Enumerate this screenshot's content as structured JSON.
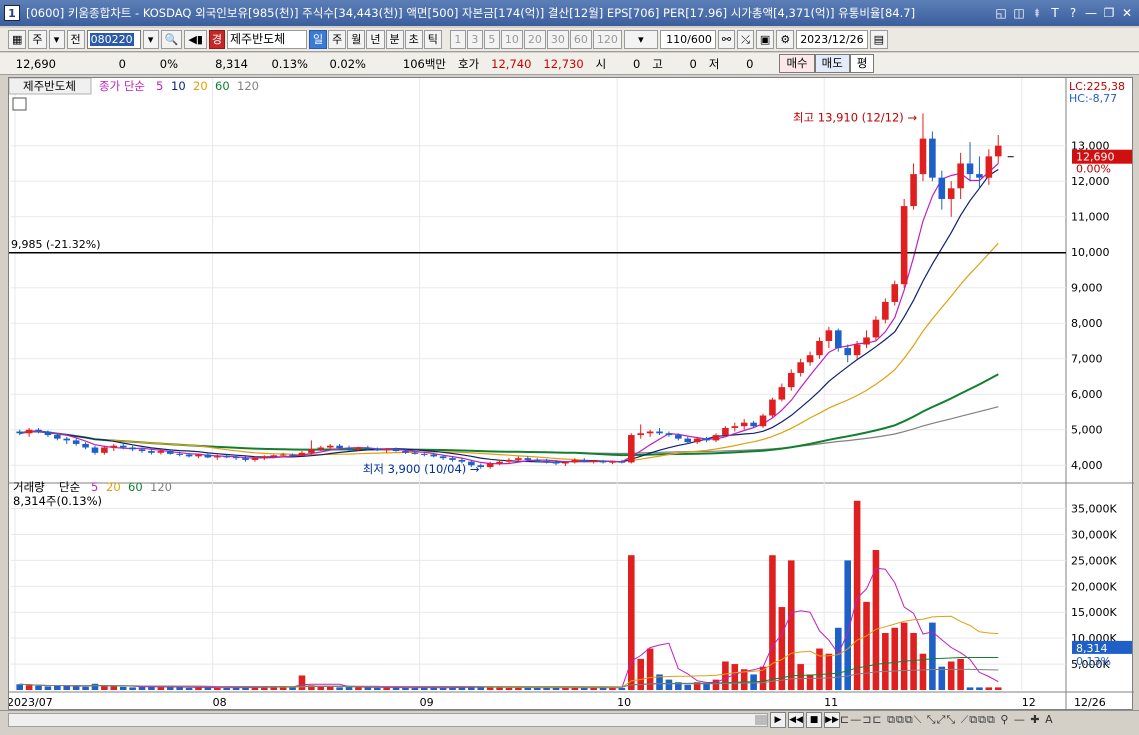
{
  "window": {
    "icon_label": "1",
    "title": "[0600] 키움종합차트 - KOSDAQ 외국인보유[985(천)] 주식수[34,443(천)] 액면[500] 자본금[174(억)] 결산[12월] EPS[706] PER[17.96] 시가총액[4,371(억)] 유통비율[84.7]",
    "controls": [
      "◱",
      "◫",
      "⯒",
      "T",
      "?",
      "—",
      "❐",
      "✕"
    ]
  },
  "toolbar": {
    "type_label": "주",
    "prev_label": "전",
    "code": "080220",
    "market_badge": "경",
    "stock_name": "제주반도체",
    "periods": [
      "일",
      "주",
      "월",
      "년",
      "분",
      "초",
      "틱"
    ],
    "active_period": "일",
    "intervals": [
      "1",
      "3",
      "5",
      "10",
      "20",
      "30",
      "60",
      "120"
    ],
    "count": "110/600",
    "date": "2023/12/26"
  },
  "info": {
    "price": "12,690",
    "change": "0",
    "change_pct": "0%",
    "volume": "8,314",
    "vol_ratio": "0.13%",
    "turnover": "0.02%",
    "amount": "106백만",
    "quote_label": "호가",
    "ask": "12,740",
    "bid": "12,730",
    "open_label": "시",
    "open": "0",
    "high_label": "고",
    "high": "0",
    "low_label": "저",
    "low": "0",
    "buy_label": "매수",
    "sell_label": "매도",
    "avg_label": "평"
  },
  "price_panel": {
    "name": "제주반도체",
    "legend_close": "종가 단순",
    "ma_periods": [
      "5",
      "10",
      "20",
      "60",
      "120"
    ],
    "lc": "LC:225,38",
    "hc": "HC:-8,77",
    "current_price": "12,690",
    "current_pct": "0.00%",
    "high_annot": "최고 13,910 (12/12)",
    "low_annot": "최저 3,900 (10/04)",
    "hline_label": "9,985 (-21.32%)",
    "y_ticks": [
      "13,000",
      "12,000",
      "11,000",
      "10,000",
      "9,000",
      "8,000",
      "7,000",
      "6,000",
      "5,000",
      "4,000"
    ]
  },
  "volume_panel": {
    "name": "거래량",
    "legend_ma": "단순",
    "ma_periods": [
      "5",
      "20",
      "60",
      "120"
    ],
    "current": "8,314주(0.13%)",
    "current_tag": "8,314",
    "current_pct": "0.13%",
    "y_ticks": [
      "35,000K",
      "30,000K",
      "25,000K",
      "20,000K",
      "15,000K",
      "10,000K",
      "5,000K"
    ]
  },
  "x_axis": [
    "2023/07",
    "08",
    "09",
    "10",
    "11",
    "12",
    "12/26"
  ],
  "colors": {
    "up": "#e02020",
    "down": "#1f5fc8",
    "ma5": "#c020c0",
    "ma10": "#102070",
    "ma20": "#e0a010",
    "ma60": "#108030",
    "ma120": "#808080"
  },
  "chart_data": {
    "type": "candlestick",
    "price_ylim": [
      3500,
      14400
    ],
    "volume_ylim": [
      0,
      38000
    ],
    "candles": [
      [
        4950,
        5000,
        4850,
        4900
      ],
      [
        4900,
        5050,
        4800,
        5000
      ],
      [
        5000,
        5050,
        4900,
        4950
      ],
      [
        4950,
        4980,
        4800,
        4850
      ],
      [
        4850,
        4900,
        4700,
        4750
      ],
      [
        4750,
        4800,
        4600,
        4700
      ],
      [
        4700,
        4750,
        4550,
        4600
      ],
      [
        4600,
        4650,
        4450,
        4500
      ],
      [
        4500,
        4550,
        4300,
        4350
      ],
      [
        4350,
        4550,
        4300,
        4500
      ],
      [
        4500,
        4600,
        4400,
        4550
      ],
      [
        4550,
        4600,
        4450,
        4500
      ],
      [
        4500,
        4550,
        4400,
        4450
      ],
      [
        4450,
        4500,
        4350,
        4400
      ],
      [
        4400,
        4450,
        4300,
        4350
      ],
      [
        4350,
        4450,
        4300,
        4400
      ],
      [
        4400,
        4420,
        4300,
        4320
      ],
      [
        4320,
        4380,
        4250,
        4300
      ],
      [
        4300,
        4350,
        4220,
        4250
      ],
      [
        4250,
        4320,
        4200,
        4300
      ],
      [
        4300,
        4330,
        4200,
        4220
      ],
      [
        4220,
        4300,
        4150,
        4250
      ],
      [
        4250,
        4300,
        4200,
        4230
      ],
      [
        4230,
        4300,
        4150,
        4200
      ],
      [
        4200,
        4250,
        4100,
        4150
      ],
      [
        4150,
        4250,
        4100,
        4200
      ],
      [
        4200,
        4280,
        4150,
        4250
      ],
      [
        4250,
        4300,
        4200,
        4280
      ],
      [
        4280,
        4350,
        4220,
        4300
      ],
      [
        4300,
        4330,
        4250,
        4270
      ],
      [
        4270,
        4400,
        4250,
        4350
      ],
      [
        4350,
        4700,
        4300,
        4450
      ],
      [
        4450,
        4550,
        4400,
        4500
      ],
      [
        4500,
        4600,
        4450,
        4550
      ],
      [
        4550,
        4600,
        4450,
        4480
      ],
      [
        4480,
        4550,
        4400,
        4450
      ],
      [
        4450,
        4520,
        4400,
        4500
      ],
      [
        4500,
        4550,
        4430,
        4470
      ],
      [
        4470,
        4500,
        4400,
        4420
      ],
      [
        4420,
        4480,
        4350,
        4450
      ],
      [
        4450,
        4500,
        4380,
        4400
      ],
      [
        4400,
        4450,
        4320,
        4350
      ],
      [
        4350,
        4400,
        4300,
        4320
      ],
      [
        4320,
        4380,
        4250,
        4300
      ],
      [
        4300,
        4350,
        4220,
        4250
      ],
      [
        4250,
        4300,
        4150,
        4200
      ],
      [
        4200,
        4250,
        4100,
        4150
      ],
      [
        4150,
        4200,
        4050,
        4100
      ],
      [
        4100,
        4150,
        3950,
        4000
      ],
      [
        4000,
        4050,
        3900,
        3950
      ],
      [
        3950,
        4100,
        3900,
        4050
      ],
      [
        4050,
        4150,
        4000,
        4100
      ],
      [
        4100,
        4200,
        4050,
        4150
      ],
      [
        4150,
        4250,
        4100,
        4200
      ],
      [
        4200,
        4250,
        4120,
        4150
      ],
      [
        4150,
        4200,
        4080,
        4120
      ],
      [
        4120,
        4180,
        4050,
        4100
      ],
      [
        4100,
        4150,
        4000,
        4050
      ],
      [
        4050,
        4120,
        3980,
        4080
      ],
      [
        4080,
        4200,
        4050,
        4150
      ],
      [
        4150,
        4200,
        4080,
        4100
      ],
      [
        4100,
        4150,
        4050,
        4120
      ],
      [
        4120,
        4150,
        4050,
        4080
      ],
      [
        4080,
        4130,
        4030,
        4100
      ],
      [
        4100,
        4150,
        4050,
        4080
      ],
      [
        4080,
        4900,
        4050,
        4850
      ],
      [
        4850,
        5150,
        4750,
        4900
      ],
      [
        4900,
        5000,
        4800,
        4950
      ],
      [
        4950,
        5050,
        4850,
        4900
      ],
      [
        4900,
        4950,
        4800,
        4850
      ],
      [
        4850,
        4900,
        4700,
        4750
      ],
      [
        4750,
        4800,
        4600,
        4650
      ],
      [
        4650,
        4800,
        4600,
        4750
      ],
      [
        4750,
        4800,
        4650,
        4700
      ],
      [
        4700,
        4900,
        4650,
        4850
      ],
      [
        4850,
        5100,
        4800,
        5050
      ],
      [
        5050,
        5200,
        4950,
        5100
      ],
      [
        5100,
        5300,
        5000,
        5200
      ],
      [
        5200,
        5250,
        5050,
        5100
      ],
      [
        5100,
        5450,
        5050,
        5400
      ],
      [
        5400,
        5900,
        5350,
        5850
      ],
      [
        5850,
        6300,
        5800,
        6200
      ],
      [
        6200,
        6700,
        6100,
        6600
      ],
      [
        6600,
        7000,
        6500,
        6900
      ],
      [
        6900,
        7200,
        6800,
        7100
      ],
      [
        7100,
        7600,
        7000,
        7500
      ],
      [
        7500,
        7900,
        7300,
        7800
      ],
      [
        7800,
        7850,
        7200,
        7300
      ],
      [
        7300,
        7400,
        6900,
        7100
      ],
      [
        7100,
        7500,
        7000,
        7400
      ],
      [
        7400,
        7800,
        7300,
        7600
      ],
      [
        7600,
        8200,
        7500,
        8100
      ],
      [
        8100,
        8700,
        8000,
        8600
      ],
      [
        8600,
        9200,
        8500,
        9100
      ],
      [
        9100,
        11500,
        9000,
        11300
      ],
      [
        11300,
        12500,
        11200,
        12200
      ],
      [
        12200,
        13910,
        12000,
        13200
      ],
      [
        13200,
        13400,
        12000,
        12100
      ],
      [
        12100,
        12300,
        11200,
        11500
      ],
      [
        11500,
        12000,
        11000,
        11800
      ],
      [
        11800,
        12800,
        11500,
        12500
      ],
      [
        12500,
        13100,
        12000,
        12200
      ],
      [
        12200,
        12700,
        11800,
        12100
      ],
      [
        12100,
        12900,
        11900,
        12700
      ],
      [
        12700,
        13300,
        12500,
        13000
      ],
      [
        12690,
        12700,
        12680,
        12690
      ],
      [
        12690,
        12700,
        12680,
        12690
      ],
      [
        12690,
        12700,
        12680,
        12690
      ],
      [
        12690,
        12700,
        12680,
        12690
      ],
      [
        12690,
        12700,
        12680,
        12690
      ]
    ],
    "volumes": [
      1100,
      900,
      800,
      700,
      800,
      900,
      700,
      600,
      1200,
      800,
      700,
      600,
      500,
      600,
      700,
      500,
      600,
      500,
      400,
      500,
      500,
      400,
      500,
      400,
      500,
      600,
      500,
      700,
      600,
      500,
      2800,
      900,
      700,
      600,
      500,
      600,
      500,
      500,
      400,
      500,
      500,
      400,
      500,
      400,
      500,
      400,
      500,
      600,
      700,
      500,
      600,
      500,
      400,
      500,
      400,
      500,
      400,
      500,
      400,
      500,
      400,
      500,
      400,
      500,
      400,
      26000,
      6000,
      8000,
      3000,
      2000,
      1500,
      1000,
      1500,
      1200,
      2000,
      5500,
      5000,
      4000,
      3000,
      4500,
      26000,
      16000,
      25000,
      5000,
      3000,
      8000,
      7000,
      12000,
      25000,
      36500,
      17000,
      27000,
      11000,
      12000,
      13000,
      11000,
      7000,
      13000,
      4500,
      5500,
      6000,
      500,
      500,
      500,
      500
    ]
  }
}
